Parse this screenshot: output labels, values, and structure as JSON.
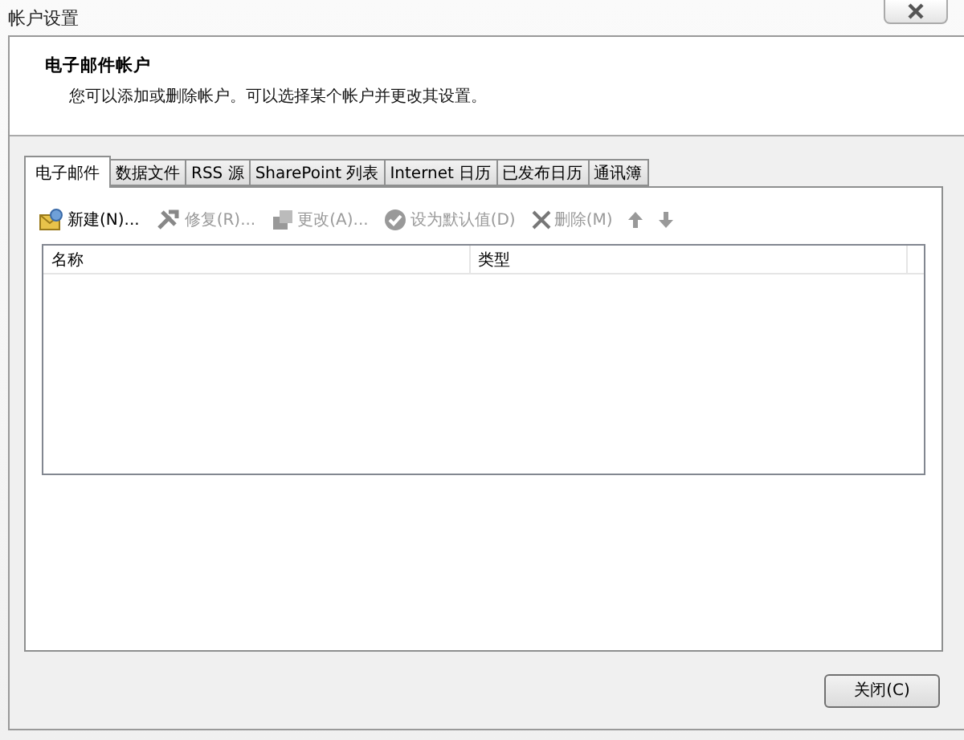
{
  "window": {
    "title": "帐户设置"
  },
  "header": {
    "title": "电子邮件帐户",
    "description": "您可以添加或删除帐户。可以选择某个帐户并更改其设置。"
  },
  "tabs": [
    {
      "label": "电子邮件",
      "selected": true
    },
    {
      "label": "数据文件",
      "selected": false
    },
    {
      "label": "RSS 源",
      "selected": false
    },
    {
      "label": "SharePoint 列表",
      "selected": false
    },
    {
      "label": "Internet 日历",
      "selected": false
    },
    {
      "label": "已发布日历",
      "selected": false
    },
    {
      "label": "通讯簿",
      "selected": false
    }
  ],
  "toolbar": [
    {
      "kind": "new",
      "label": "新建(N)...",
      "disabled": false
    },
    {
      "kind": "repair",
      "label": "修复(R)...",
      "disabled": true
    },
    {
      "kind": "change",
      "label": "更改(A)...",
      "disabled": true
    },
    {
      "kind": "default",
      "label": "设为默认值(D)",
      "disabled": true
    },
    {
      "kind": "delete",
      "label": "删除(M)",
      "disabled": true
    },
    {
      "kind": "up",
      "disabled": true
    },
    {
      "kind": "down",
      "disabled": true
    }
  ],
  "table": {
    "columns": [
      "名称",
      "类型"
    ]
  },
  "buttons": [
    "关闭(C)"
  ]
}
